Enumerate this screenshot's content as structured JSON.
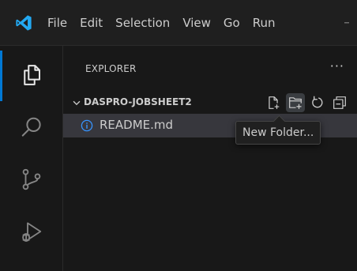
{
  "menu": {
    "items": [
      "File",
      "Edit",
      "Selection",
      "View",
      "Go",
      "Run"
    ]
  },
  "activity_bar": {
    "items": [
      {
        "name": "explorer",
        "icon": "files-icon",
        "active": true
      },
      {
        "name": "search",
        "icon": "search-icon",
        "active": false
      },
      {
        "name": "source-control",
        "icon": "source-control-icon",
        "active": false
      },
      {
        "name": "run-debug",
        "icon": "run-debug-icon",
        "active": false
      }
    ]
  },
  "explorer": {
    "title": "EXPLORER",
    "more": "···",
    "folder": {
      "name": "DASPRO-JOBSHEET2",
      "actions": [
        "new-file-icon",
        "new-folder-icon",
        "refresh-icon",
        "collapse-all-icon"
      ]
    },
    "files": [
      {
        "name": "README.md",
        "icon": "info-icon"
      }
    ]
  },
  "tooltip": {
    "text": "New Folder..."
  },
  "colors": {
    "accent": "#0078d4",
    "background": "#181818",
    "selected_row": "#37373d",
    "info_icon": "#3794ff"
  }
}
